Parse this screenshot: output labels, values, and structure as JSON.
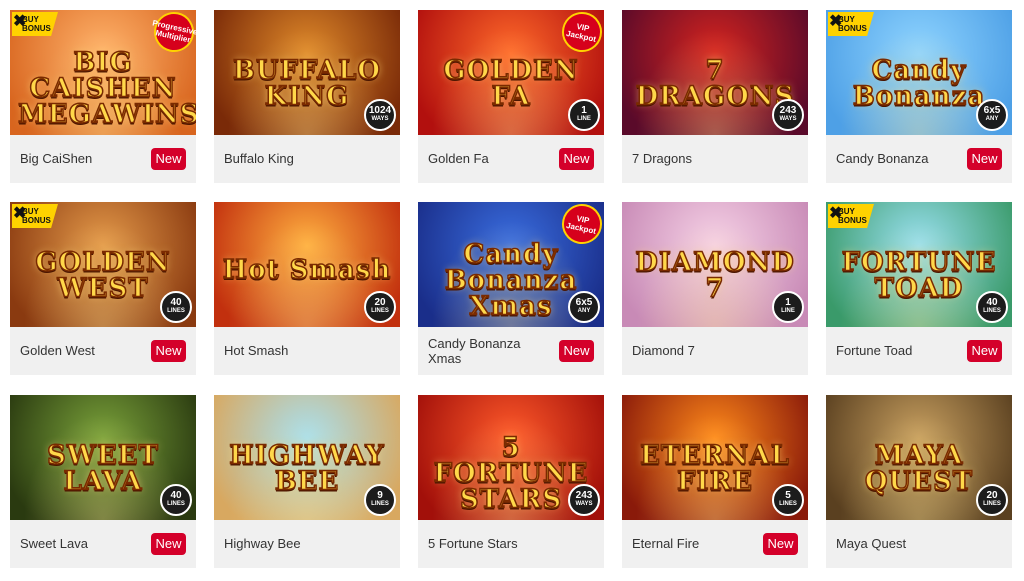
{
  "colors": {
    "new_badge": "#d4002a",
    "card_bg": "#f0f0f0",
    "name_text": "#333333"
  },
  "games": [
    {
      "name": "Big CaiShen",
      "new": "New",
      "art_title": "BIG CAISHEN MEGAWINS",
      "art_badge": null,
      "buy_bonus": "BUY BONUS",
      "corner": "Progressive Multiplier",
      "bg": [
        "#ffb36b",
        "#d8651f"
      ]
    },
    {
      "name": "Buffalo King",
      "new": null,
      "art_title": "BUFFALO KING",
      "art_badge": {
        "n": "1024",
        "u": "WAYS"
      },
      "buy_bonus": null,
      "corner": null,
      "bg": [
        "#e08a2a",
        "#7a2a08"
      ]
    },
    {
      "name": "Golden Fa",
      "new": "New",
      "art_title": "GOLDEN FA",
      "art_badge": {
        "n": "1",
        "u": "LINE"
      },
      "buy_bonus": null,
      "corner": "VIP Jackpot",
      "bg": [
        "#ff6a2a",
        "#b2100e"
      ]
    },
    {
      "name": "7 Dragons",
      "new": null,
      "art_title": "7 DRAGONS",
      "art_badge": {
        "n": "243",
        "u": "WAYS"
      },
      "buy_bonus": null,
      "corner": null,
      "bg": [
        "#d6241e",
        "#5a0a2a"
      ]
    },
    {
      "name": "Candy Bonanza",
      "new": "New",
      "art_title": "Candy Bonanza",
      "art_badge": {
        "n": "6x5",
        "u": "ANY"
      },
      "buy_bonus": "BUY BONUS",
      "corner": null,
      "bg": [
        "#8fd4ff",
        "#4ea0e6"
      ]
    },
    {
      "name": "Golden West",
      "new": "New",
      "art_title": "GOLDEN WEST",
      "art_badge": {
        "n": "40",
        "u": "LINES"
      },
      "buy_bonus": "BUY BONUS",
      "corner": null,
      "bg": [
        "#e49a4a",
        "#8a3a10"
      ]
    },
    {
      "name": "Hot Smash",
      "new": null,
      "art_title": "Hot Smash",
      "art_badge": {
        "n": "20",
        "u": "LINES"
      },
      "buy_bonus": null,
      "corner": null,
      "bg": [
        "#ffb040",
        "#c2300e"
      ]
    },
    {
      "name": "Candy Bonanza Xmas",
      "new": "New",
      "art_title": "Candy Bonanza Xmas",
      "art_badge": {
        "n": "6x5",
        "u": "ANY"
      },
      "buy_bonus": null,
      "corner": "VIP Jackpot",
      "bg": [
        "#3a6ee0",
        "#1a2e8a"
      ]
    },
    {
      "name": "Diamond 7",
      "new": null,
      "art_title": "DIAMOND 7",
      "art_badge": {
        "n": "1",
        "u": "LINE"
      },
      "buy_bonus": null,
      "corner": null,
      "bg": [
        "#f6d2e6",
        "#c88ab6"
      ]
    },
    {
      "name": "Fortune Toad",
      "new": "New",
      "art_title": "FORTUNE TOAD",
      "art_badge": {
        "n": "40",
        "u": "LINES"
      },
      "buy_bonus": "BUY BONUS",
      "corner": null,
      "bg": [
        "#9ae0f0",
        "#3a9a6a"
      ]
    },
    {
      "name": "Sweet Lava",
      "new": "New",
      "art_title": "SWEET LAVA",
      "art_badge": {
        "n": "40",
        "u": "LINES"
      },
      "buy_bonus": null,
      "corner": null,
      "bg": [
        "#7aa23a",
        "#2a3a10"
      ]
    },
    {
      "name": "Highway Bee",
      "new": null,
      "art_title": "HIGHWAY BEE",
      "art_badge": {
        "n": "9",
        "u": "LINES"
      },
      "buy_bonus": null,
      "corner": null,
      "bg": [
        "#a8e0f0",
        "#d8a860"
      ]
    },
    {
      "name": "5 Fortune Stars",
      "new": null,
      "art_title": "5 FORTUNE STARS",
      "art_badge": {
        "n": "243",
        "u": "WAYS"
      },
      "buy_bonus": null,
      "corner": null,
      "bg": [
        "#ff5a2a",
        "#a2100a"
      ]
    },
    {
      "name": "Eternal Fire",
      "new": "New",
      "art_title": "ETERNAL FIRE",
      "art_badge": {
        "n": "5",
        "u": "LINES"
      },
      "buy_bonus": null,
      "corner": null,
      "bg": [
        "#ff8a1a",
        "#8a1a0a"
      ]
    },
    {
      "name": "Maya Quest",
      "new": null,
      "art_title": "MAYA QUEST",
      "art_badge": {
        "n": "20",
        "u": "LINES"
      },
      "buy_bonus": null,
      "corner": null,
      "bg": [
        "#c8a060",
        "#5a4020"
      ]
    }
  ]
}
